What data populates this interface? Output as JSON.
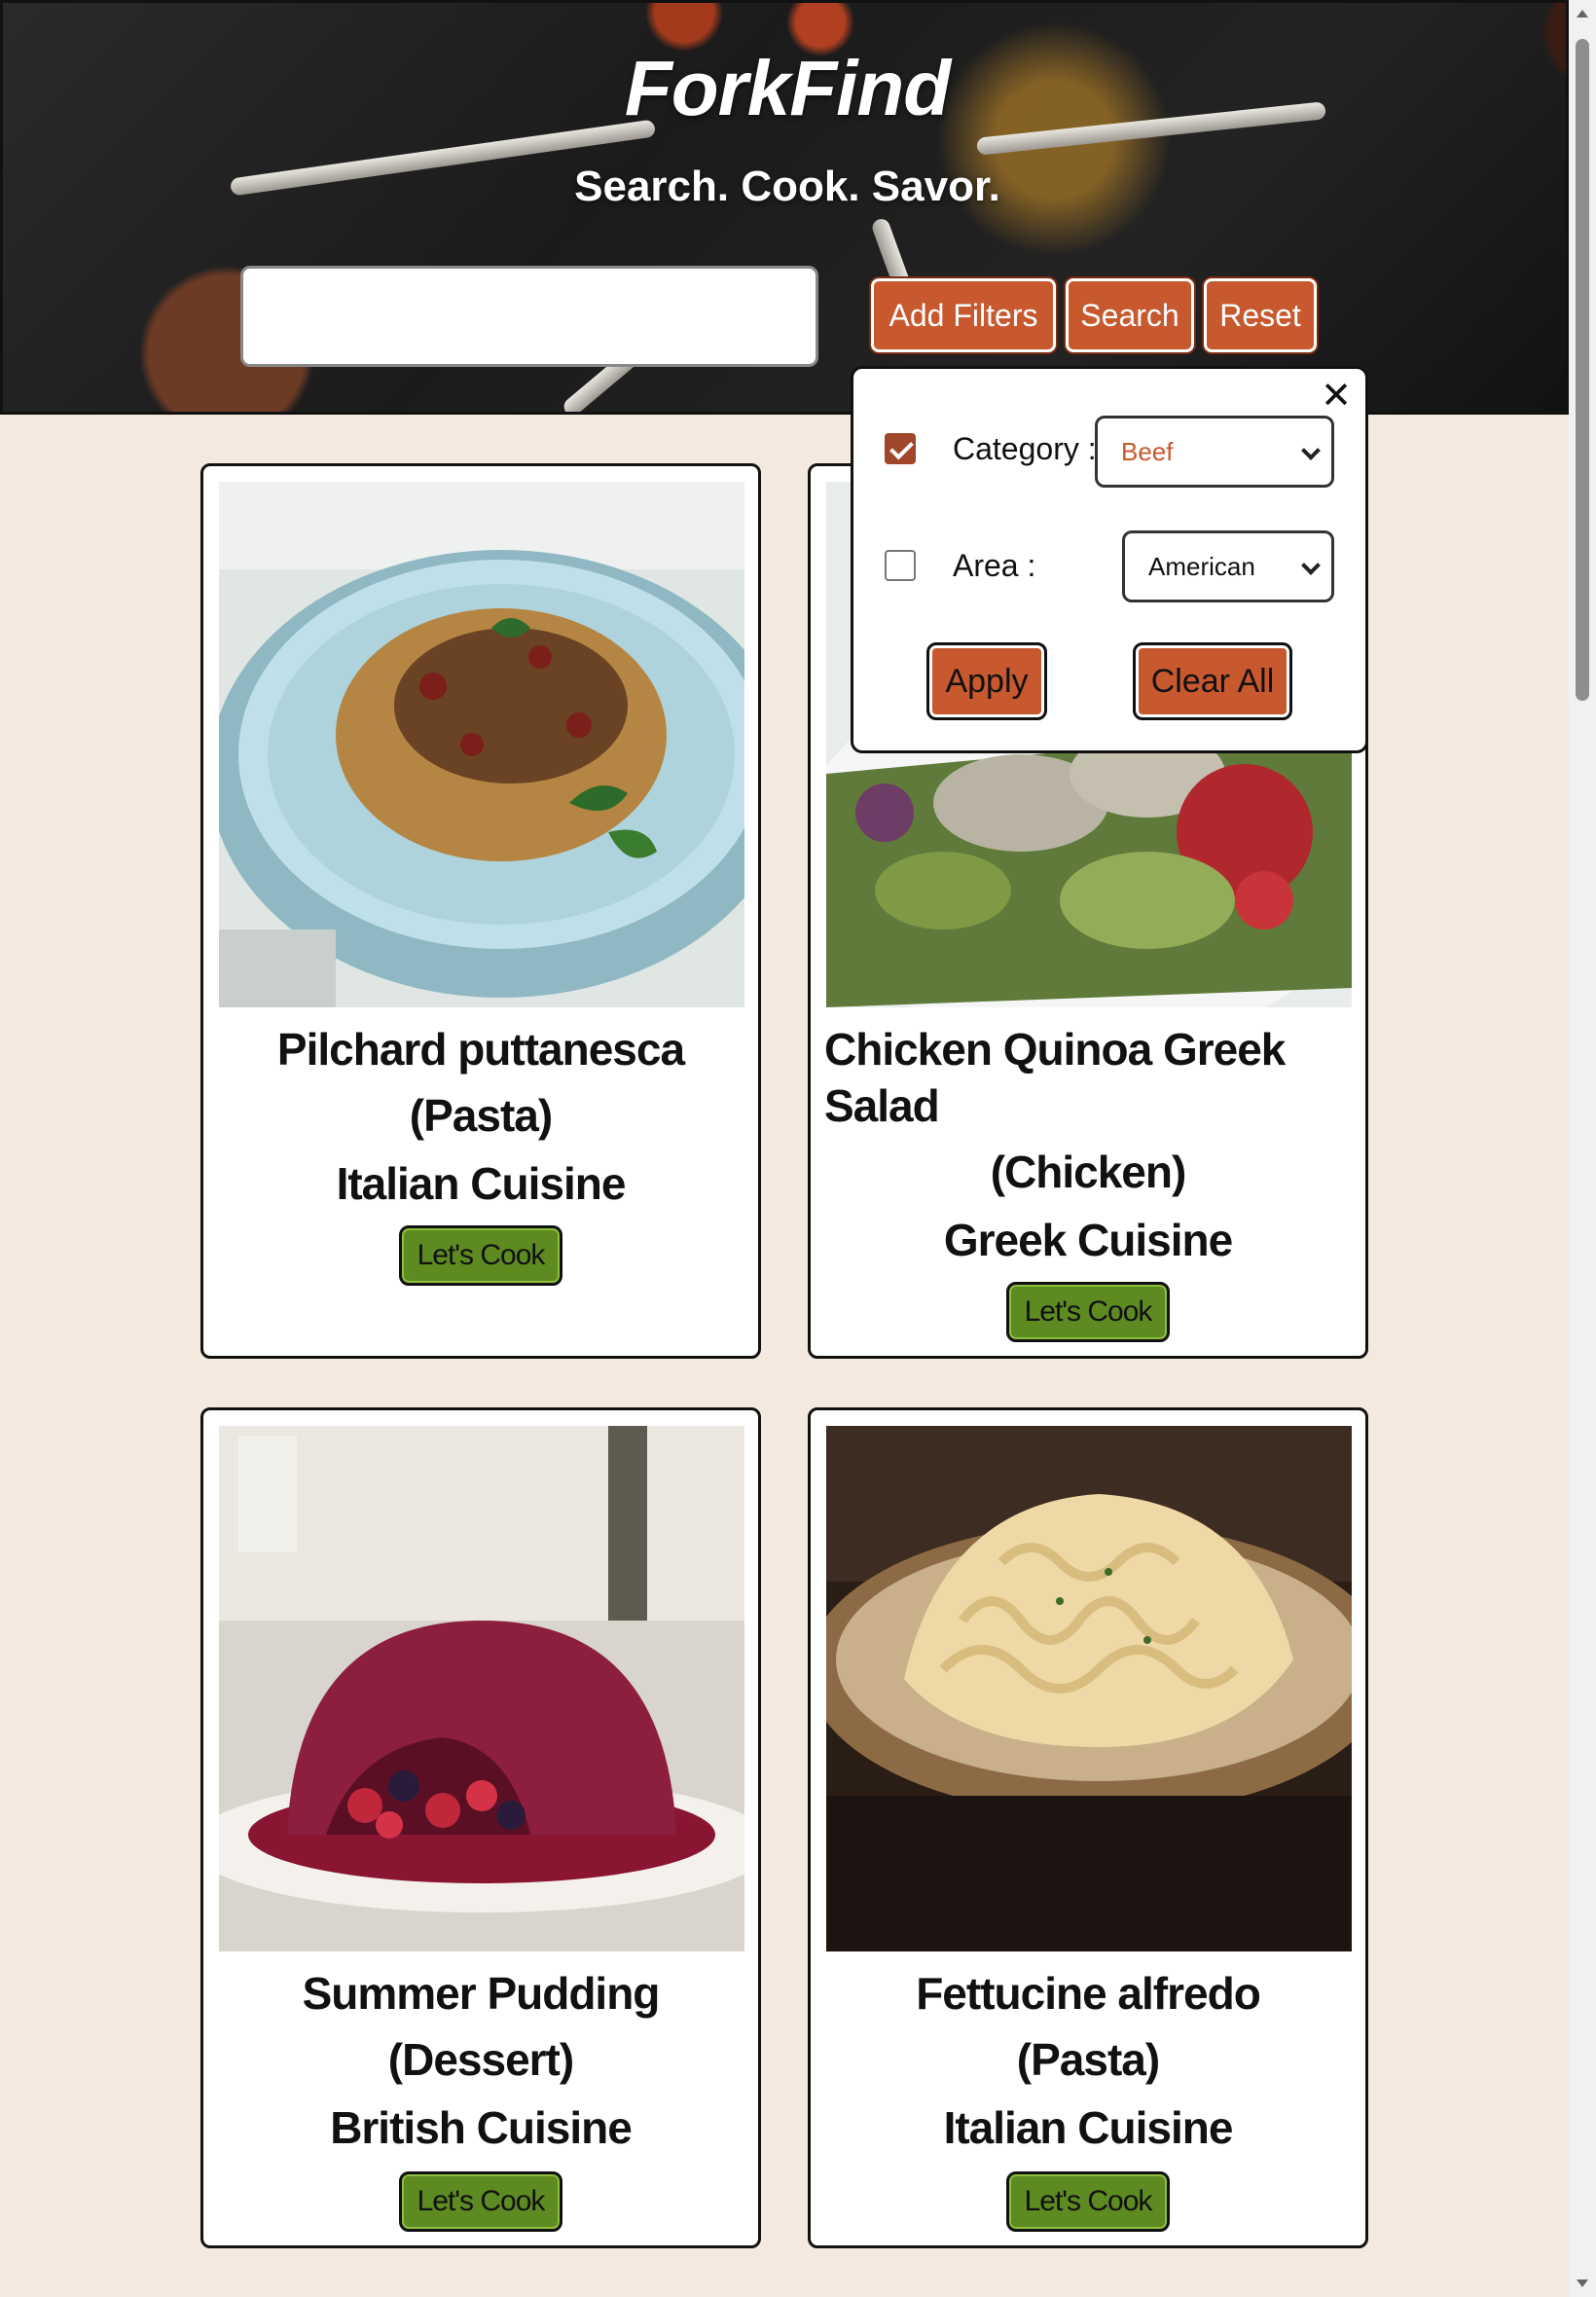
{
  "header": {
    "brand": "ForkFind",
    "tagline": "Search. Cook. Savor.",
    "search": {
      "value": "",
      "placeholder": ""
    },
    "buttons": {
      "add_filters": "Add Filters",
      "search": "Search",
      "reset": "Reset"
    }
  },
  "filters": {
    "close_glyph": "✕",
    "category": {
      "label": "Category :",
      "checked": true,
      "selected": "Beef"
    },
    "area": {
      "label": "Area :",
      "checked": false,
      "selected": "American"
    },
    "apply_label": "Apply",
    "clear_label": "Clear All"
  },
  "cards": [
    {
      "title": "Pilchard puttanesca",
      "category": "(Pasta)",
      "cuisine": "Italian Cuisine",
      "cta": "Let's Cook",
      "image": "pasta-dish-image"
    },
    {
      "title": "Chicken Quinoa Greek Salad",
      "category": "(Chicken)",
      "cuisine": "Greek Cuisine",
      "cta": "Let's Cook",
      "image": "salad-dish-image"
    },
    {
      "title": "Summer Pudding",
      "category": "(Dessert)",
      "cuisine": "British Cuisine",
      "cta": "Let's Cook",
      "image": "pudding-dish-image"
    },
    {
      "title": "Fettucine alfredo",
      "category": "(Pasta)",
      "cuisine": "Italian Cuisine",
      "cta": "Let's Cook",
      "image": "fettucine-dish-image"
    }
  ],
  "colors": {
    "accent": "#c8582e",
    "cook_button": "#5e8a22",
    "background": "#f3e9df",
    "checkbox": "#a0462a"
  }
}
